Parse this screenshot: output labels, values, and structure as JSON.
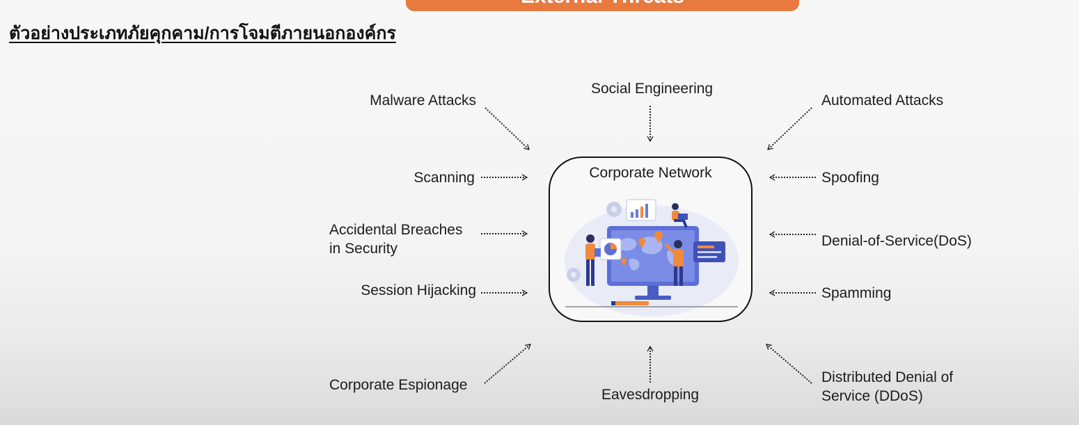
{
  "banner": {
    "title": "External Threats"
  },
  "subtitle": "ตัวอย่างประเภทภัยคุกคาม/การโจมตีภายนอกองค์กร",
  "center": {
    "title": "Corporate Network"
  },
  "threats": {
    "malware": "Malware Attacks",
    "social": "Social Engineering",
    "automated": "Automated Attacks",
    "scanning": "Scanning",
    "spoofing": "Spoofing",
    "accidental_1": "Accidental Breaches",
    "accidental_2": "in Security",
    "dos": "Denial-of-Service(DoS)",
    "session": "Session Hijacking",
    "spamming": "Spamming",
    "espionage": "Corporate Espionage",
    "eavesdropping": "Eavesdropping",
    "ddos_1": "Distributed Denial of",
    "ddos_2": "Service (DDoS)"
  },
  "colors": {
    "accent": "#e8793f",
    "illustration_blue": "#5c6fd6",
    "illustration_orange": "#f08a3c"
  }
}
